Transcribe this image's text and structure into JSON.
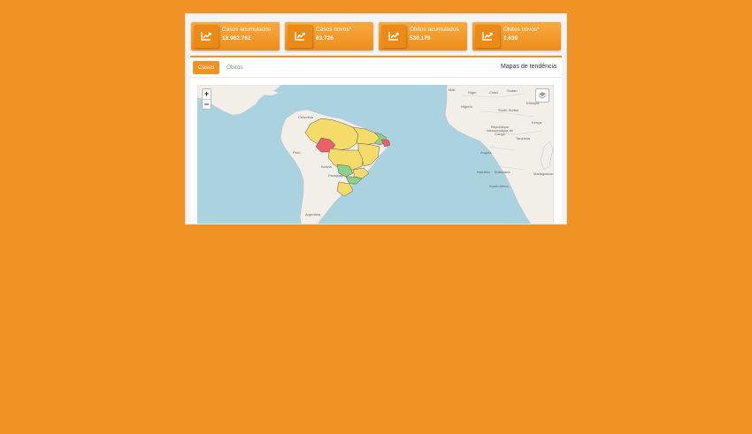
{
  "cards": [
    {
      "label": "Casos acumulados",
      "value": "18.962.762",
      "icon": "trend-chart-icon"
    },
    {
      "label": "Casos novos*",
      "value": "63.726",
      "icon": "trend-chart-icon"
    },
    {
      "label": "Óbitos acumulados",
      "value": "530.179",
      "icon": "trend-chart-icon"
    },
    {
      "label": "Óbitos novos*",
      "value": "1.639",
      "icon": "trend-chart-icon"
    }
  ],
  "tabs": [
    {
      "label": "Casos",
      "active": true
    },
    {
      "label": "Óbitos",
      "active": false
    }
  ],
  "map_title": "Mapas de tendência",
  "map": {
    "zoom_in": "+",
    "zoom_out": "−",
    "place_labels": {
      "colombia": "Colombia",
      "peru": "Perú",
      "bolivia": "Bolivia",
      "paraguay": "Paraguay",
      "argentina": "Argentina",
      "mali": "Mali",
      "niger": "Niger",
      "chad": "Chad",
      "sudan": "Sudan",
      "south_sudan": "South Sudan",
      "nigeria": "Nigeria",
      "ethiopia": "Ethiopia",
      "kenya": "Kenya",
      "drc": "République démocratique du Congo",
      "tanzania": "Tanzania",
      "angola": "Angola",
      "namibia": "Namibia",
      "botswana": "Botswana",
      "south_africa": "South Africa",
      "madagascar": "Madagascar"
    }
  },
  "colors": {
    "accent": "#f09224",
    "ocean": "#aad3df",
    "land": "#f2efe9",
    "trend_up": "#e8606a",
    "trend_stable": "#f5dc6a",
    "trend_down": "#8fcf8a"
  }
}
